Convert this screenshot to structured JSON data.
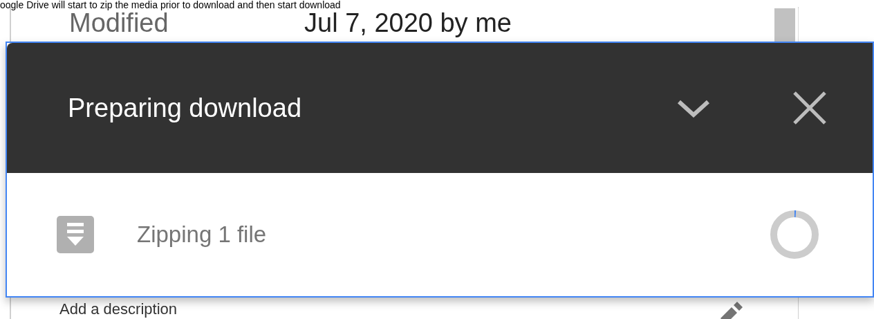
{
  "caption": "oogle Drive will start to zip the media prior to download and then start download",
  "details": {
    "label": "Modified",
    "value": "Jul 7, 2020 by me"
  },
  "download_panel": {
    "title": "Preparing download",
    "expanded": true,
    "items": [
      {
        "text": "Zipping 1 file",
        "level": 0.01
      }
    ]
  },
  "description": {
    "placeholder": "Add a description"
  }
}
